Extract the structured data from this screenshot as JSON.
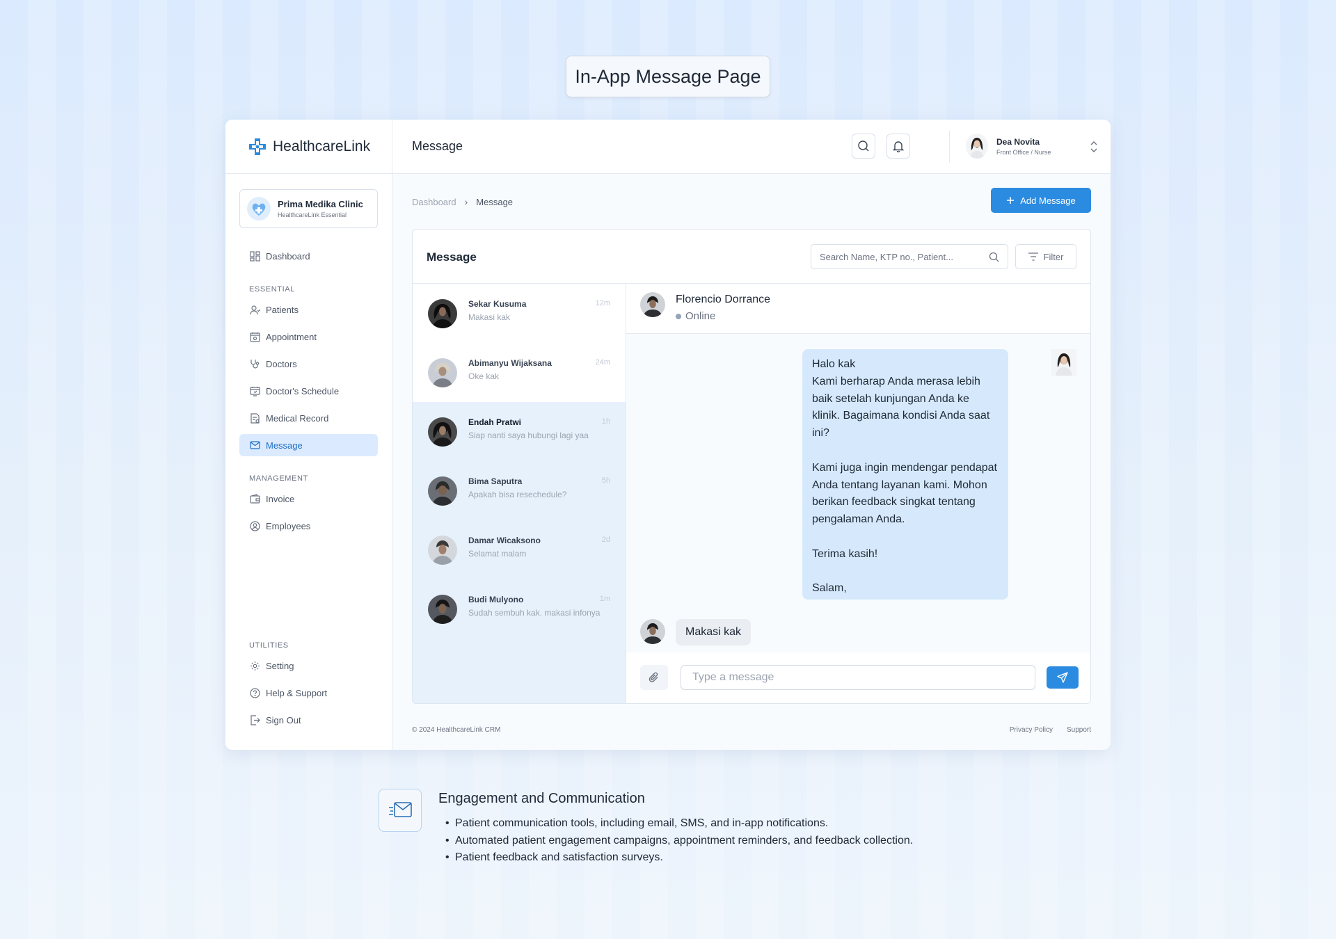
{
  "page_label": "In-App Message Page",
  "brand": {
    "name": "HealthcareLink"
  },
  "clinic": {
    "name": "Prima Medika Clinic",
    "plan": "HealthcareLink Essential"
  },
  "sidebar": {
    "dashboard": "Dashboard",
    "sections": {
      "essential": "ESSENTIAL",
      "management": "MANAGEMENT",
      "utilities": "UTILITIES"
    },
    "essential_items": [
      "Patients",
      "Appointment",
      "Doctors",
      "Doctor's Schedule",
      "Medical Record",
      "Message"
    ],
    "management_items": [
      "Invoice",
      "Employees"
    ],
    "utility_items": [
      "Setting",
      "Help & Support",
      "Sign Out"
    ],
    "active_item": "Message"
  },
  "header": {
    "title": "Message",
    "user": {
      "name": "Dea Novita",
      "role": "Front Office / Nurse"
    }
  },
  "breadcrumb": {
    "home": "Dashboard",
    "current": "Message"
  },
  "add_button": "Add Message",
  "panel": {
    "title": "Message",
    "search_placeholder": "Search Name, KTP no., Patient...",
    "filter_label": "Filter"
  },
  "conversations": [
    {
      "name": "Sekar Kusuma",
      "preview": "Makasi kak",
      "time": "12m"
    },
    {
      "name": "Abimanyu Wijaksana",
      "preview": "Oke kak",
      "time": "24m"
    },
    {
      "name": "Endah Pratwi",
      "preview": "Siap nanti saya hubungi lagi yaa",
      "time": "1h"
    },
    {
      "name": "Bima Saputra",
      "preview": "Apakah bisa resechedule?",
      "time": "5h"
    },
    {
      "name": "Damar Wicaksono",
      "preview": "Selamat malam",
      "time": "2d"
    },
    {
      "name": "Budi Mulyono",
      "preview": "Sudah sembuh kak. makasi infonya",
      "time": "1m"
    }
  ],
  "chat": {
    "contact": "Florencio Dorrance",
    "status": "Online",
    "outgoing": "Halo kak\nKami berharap Anda merasa lebih baik setelah kunjungan Anda ke klinik. Bagaimana kondisi Anda saat ini?\n\nKami juga ingin mendengar pendapat Anda tentang layanan kami. Mohon berikan feedback singkat tentang pengalaman Anda.\n\nTerima kasih!\n\nSalam,",
    "incoming": "Makasi kak",
    "input_placeholder": "Type a message"
  },
  "footer": {
    "copyright": "© 2024 HealthcareLink CRM",
    "links": [
      "Privacy Policy",
      "Support"
    ]
  },
  "feature": {
    "title": "Engagement and Communication",
    "points": [
      "Patient communication tools, including email, SMS, and in-app notifications.",
      "Automated patient engagement campaigns, appointment reminders, and feedback collection.",
      "Patient feedback and satisfaction surveys."
    ]
  },
  "colors": {
    "accent": "#2b8be0",
    "active_bg": "#dbeafe",
    "list_bg": "#e6f1fc",
    "bubble_out": "#d6e9fc"
  }
}
